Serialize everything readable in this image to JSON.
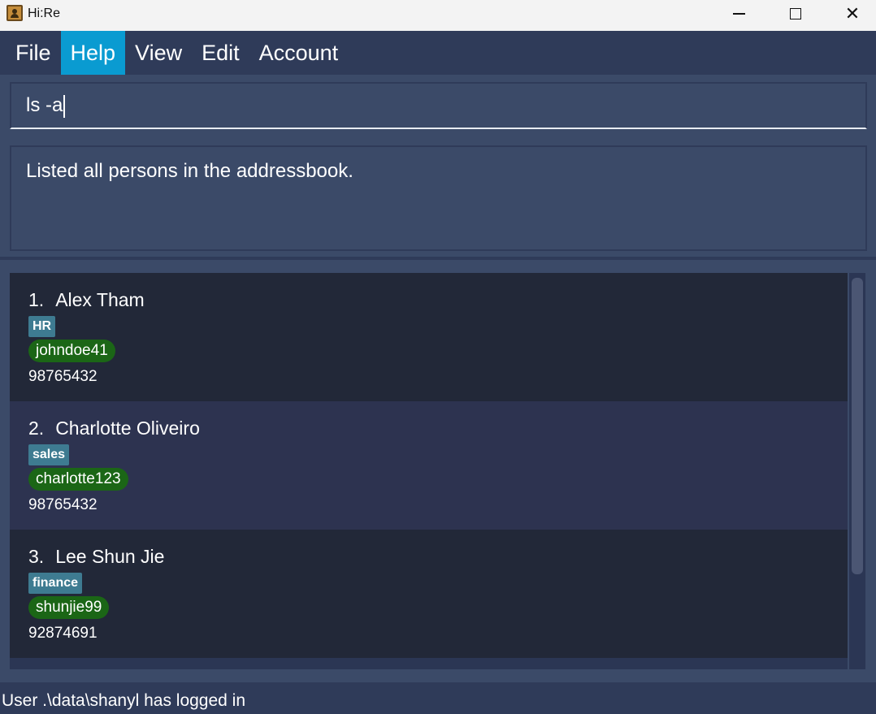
{
  "window": {
    "title": "Hi:Re",
    "minimize_label": "Minimize",
    "maximize_label": "Maximize",
    "close_label": "Close"
  },
  "menu": {
    "items": [
      {
        "label": "File",
        "active": false
      },
      {
        "label": "Help",
        "active": true
      },
      {
        "label": "View",
        "active": false
      },
      {
        "label": "Edit",
        "active": false
      },
      {
        "label": "Account",
        "active": false
      }
    ]
  },
  "command": {
    "value": "ls -a"
  },
  "result": {
    "message": "Listed all persons in the addressbook."
  },
  "persons": [
    {
      "index": "1.",
      "name": "Alex Tham",
      "tag": "HR",
      "username": "johndoe41",
      "phone": "98765432"
    },
    {
      "index": "2.",
      "name": "Charlotte Oliveiro",
      "tag": "sales",
      "username": "charlotte123",
      "phone": "98765432"
    },
    {
      "index": "3.",
      "name": "Lee Shun Jie",
      "tag": "finance",
      "username": "shunjie99",
      "phone": "92874691"
    }
  ],
  "status": {
    "text": "User .\\data\\shanyl has logged in"
  },
  "colors": {
    "accent": "#0a9bd1",
    "background": "#3b4a68",
    "menubar": "#2f3b59",
    "tag": "#3e7b91",
    "username_badge": "#1b6616"
  }
}
